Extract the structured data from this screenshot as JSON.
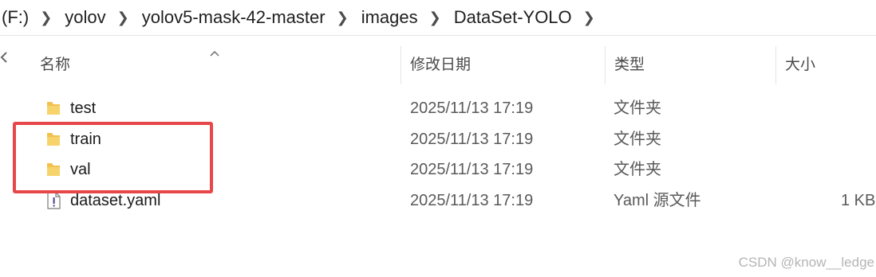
{
  "breadcrumb": {
    "items": [
      "(F:)",
      "yolov",
      "yolov5-mask-42-master",
      "images",
      "DataSet-YOLO"
    ]
  },
  "columns": {
    "name": "名称",
    "modified": "修改日期",
    "type": "类型",
    "size": "大小"
  },
  "files": [
    {
      "name": "test",
      "modified": "2025/11/13 17:19",
      "type": "文件夹",
      "size": "",
      "icon": "folder-icon"
    },
    {
      "name": "train",
      "modified": "2025/11/13 17:19",
      "type": "文件夹",
      "size": "",
      "icon": "folder-icon"
    },
    {
      "name": "val",
      "modified": "2025/11/13 17:19",
      "type": "文件夹",
      "size": "",
      "icon": "folder-icon"
    },
    {
      "name": "dataset.yaml",
      "modified": "2025/11/13 17:19",
      "type": "Yaml 源文件",
      "size": "1 KB",
      "icon": "yaml-file-icon"
    }
  ],
  "highlight_color": "#e8474a",
  "folder_color": "#f2c14e",
  "watermark": "CSDN @know__ledge"
}
